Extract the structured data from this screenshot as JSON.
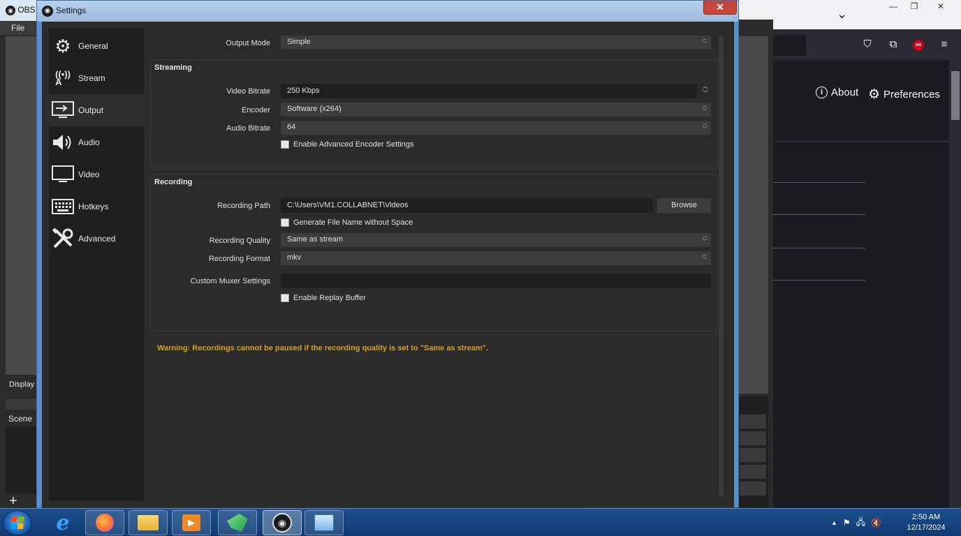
{
  "obs_main": {
    "title": "OBS",
    "menu_file": "File",
    "display_label": "Display",
    "scenes_label": "Scene",
    "add_icon": "+"
  },
  "firefox": {
    "about_label": "About",
    "preferences_label": "Preferences",
    "close_glyph": "✕",
    "minimize_glyph": "—",
    "restore_glyph": "❐",
    "chevron_glyph": "⌄",
    "ublock_label": "uo"
  },
  "settings": {
    "title": "Settings",
    "close_glyph": "✕",
    "sidebar": [
      {
        "label": "General",
        "icon": "gear-icon",
        "glyph": "⚙",
        "active": false
      },
      {
        "label": "Stream",
        "icon": "antenna-icon",
        "glyph": "📡",
        "active": false
      },
      {
        "label": "Output",
        "icon": "output-icon",
        "glyph": "🖥",
        "active": true
      },
      {
        "label": "Audio",
        "icon": "speaker-icon",
        "glyph": "🔊",
        "active": false
      },
      {
        "label": "Video",
        "icon": "monitor-icon",
        "glyph": "🖵",
        "active": false
      },
      {
        "label": "Hotkeys",
        "icon": "keyboard-icon",
        "glyph": "⌨",
        "active": false
      },
      {
        "label": "Advanced",
        "icon": "tools-icon",
        "glyph": "🛠",
        "active": false
      }
    ],
    "output_mode": {
      "label": "Output Mode",
      "value": "Simple"
    },
    "streaming": {
      "title": "Streaming",
      "video_bitrate": {
        "label": "Video Bitrate",
        "value": "250 Kbps"
      },
      "encoder": {
        "label": "Encoder",
        "value": "Software (x264)"
      },
      "audio_bitrate": {
        "label": "Audio Bitrate",
        "value": "64"
      },
      "advanced_encoder": {
        "label": "Enable Advanced Encoder Settings",
        "checked": false
      }
    },
    "recording": {
      "title": "Recording",
      "path": {
        "label": "Recording Path",
        "value": "C:\\Users\\VM1.COLLABNET\\Videos"
      },
      "browse_label": "Browse",
      "no_space": {
        "label": "Generate File Name without Space",
        "checked": false
      },
      "quality": {
        "label": "Recording Quality",
        "value": "Same as stream"
      },
      "format": {
        "label": "Recording Format",
        "value": "mkv"
      },
      "muxer": {
        "label": "Custom Muxer Settings",
        "value": ""
      },
      "replay_buffer": {
        "label": "Enable Replay Buffer",
        "checked": false
      }
    },
    "warning": "Warning: Recordings cannot be paused if the recording quality is set to \"Same as stream\"."
  },
  "taskbar": {
    "apps": [
      {
        "name": "internet-explorer",
        "glyph": "e",
        "color": "#3aa0ff",
        "state": "plain"
      },
      {
        "name": "firefox",
        "glyph": "🦊",
        "color": "#ff7139",
        "state": "pinned"
      },
      {
        "name": "file-explorer",
        "glyph": "📁",
        "color": "#f3c84a",
        "state": "pinned"
      },
      {
        "name": "media-player",
        "glyph": "▶",
        "color": "#f08a24",
        "state": "pinned"
      },
      {
        "name": "app-green",
        "glyph": "◆",
        "color": "#3cc16a",
        "state": "pinned"
      },
      {
        "name": "obs-studio",
        "glyph": "●",
        "color": "#1b1b1b",
        "state": "active"
      },
      {
        "name": "control-panel",
        "glyph": "▦",
        "color": "#9fd0ff",
        "state": "pinned"
      }
    ],
    "tray": {
      "show_hidden": "▲",
      "flag": "⚑",
      "network": "🖧",
      "volume": "🔇"
    },
    "clock_time": "2:50 AM",
    "clock_date": "12/17/2024"
  }
}
